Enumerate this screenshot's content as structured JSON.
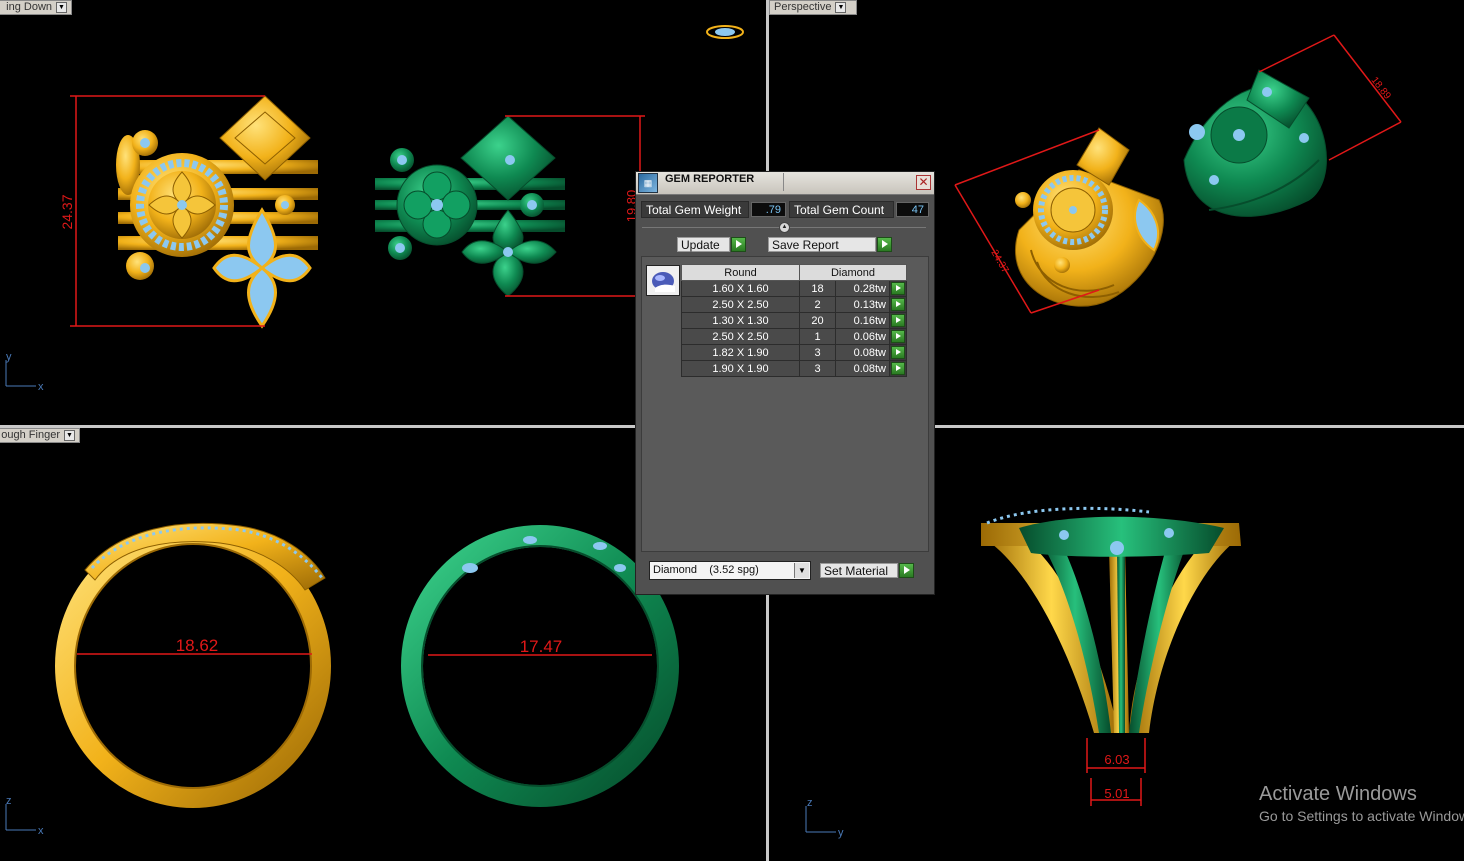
{
  "viewports": {
    "top_left": {
      "label": "ing Down",
      "dims": [
        "24.37",
        "19.80"
      ],
      "axes": [
        "y",
        "x"
      ]
    },
    "top_right": {
      "label": "Perspective",
      "dims": [
        "18.89",
        "24.37"
      ]
    },
    "bottom_left": {
      "label": "ough Finger",
      "dims": [
        "18.62",
        "17.47"
      ],
      "axes": [
        "z",
        "x"
      ]
    },
    "bottom_right": {
      "dims": [
        "6.03",
        "5.01"
      ],
      "axes": [
        "z",
        "y"
      ]
    }
  },
  "gem_reporter": {
    "title": "GEM REPORTER",
    "total_weight_label": "Total Gem Weight",
    "total_weight_value": ".79",
    "total_count_label": "Total Gem Count",
    "total_count_value": "47",
    "update_label": "Update",
    "save_report_label": "Save Report",
    "table": {
      "headers": [
        "Round",
        "Diamond"
      ],
      "rows": [
        {
          "size": "1.60 X 1.60",
          "count": "18",
          "weight": "0.28tw"
        },
        {
          "size": "2.50 X 2.50",
          "count": "2",
          "weight": "0.13tw"
        },
        {
          "size": "1.30 X 1.30",
          "count": "20",
          "weight": "0.16tw"
        },
        {
          "size": "2.50 X 2.50",
          "count": "1",
          "weight": "0.06tw"
        },
        {
          "size": "1.82 X 1.90",
          "count": "3",
          "weight": "0.08tw"
        },
        {
          "size": "1.90 X 1.90",
          "count": "3",
          "weight": "0.08tw"
        }
      ]
    },
    "material_value": "Diamond    (3.52 spg)",
    "set_material_label": "Set Material"
  },
  "watermark": {
    "line1": "Activate Windows",
    "line2": "Go to Settings to activate Windows."
  },
  "colors": {
    "gold": "#f2b21a",
    "green": "#0f8a52",
    "gem": "#8cc8f0",
    "dimension": "#e01818"
  }
}
